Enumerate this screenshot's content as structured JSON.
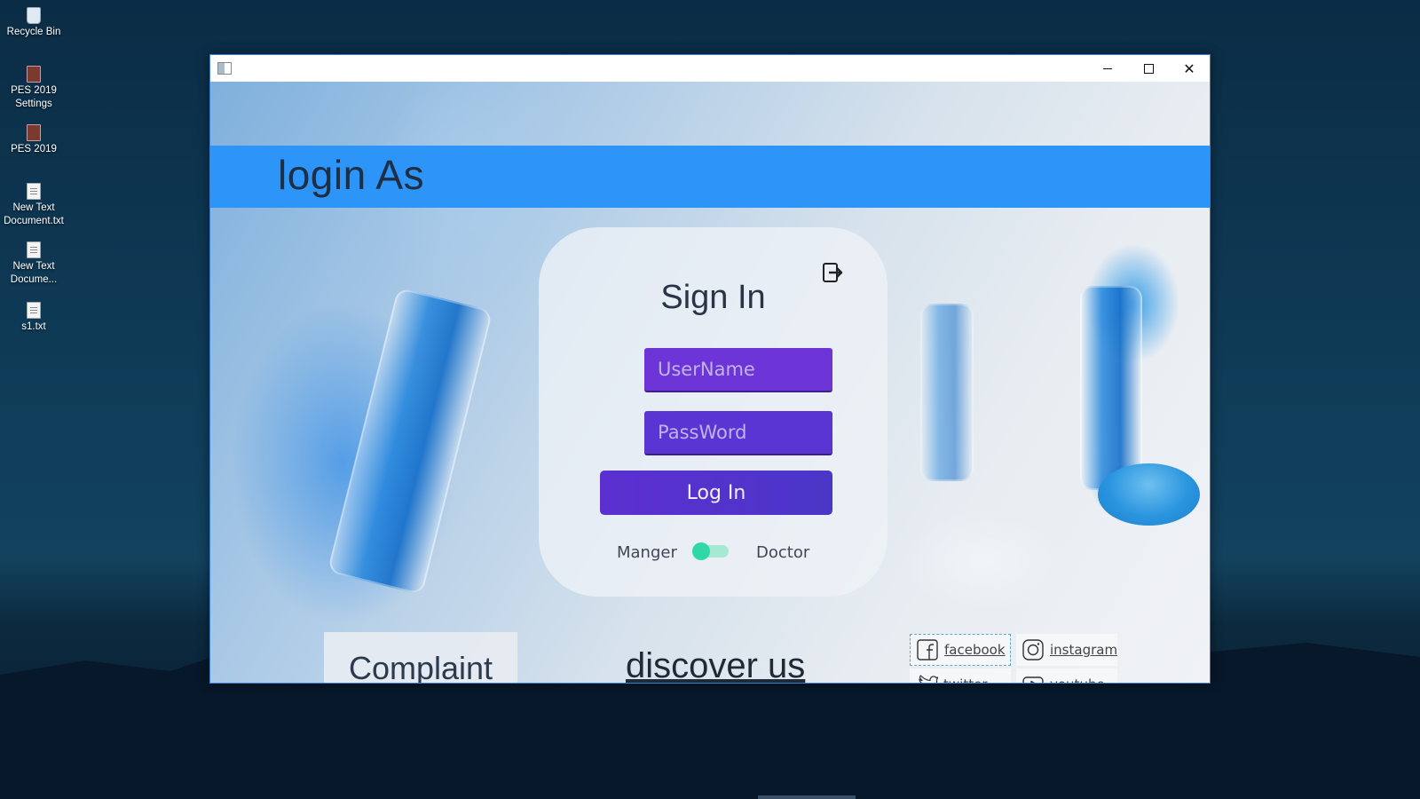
{
  "desktop": {
    "icons": [
      {
        "label": "Recycle Bin",
        "icon": "recycle-bin-icon"
      },
      {
        "label": "PES 2019 Settings",
        "icon": "app-icon"
      },
      {
        "label": "PES 2019",
        "icon": "app-icon"
      },
      {
        "label": "New Text Document.txt",
        "icon": "text-file-icon"
      },
      {
        "label": "New Text Docume...",
        "icon": "text-file-icon"
      },
      {
        "label": "s1.txt",
        "icon": "text-file-icon"
      }
    ]
  },
  "window": {
    "controls": {
      "minimize": "–",
      "maximize": "□",
      "close": "✕"
    }
  },
  "header": {
    "title": "login As",
    "band_color": "#2d95f8"
  },
  "signin": {
    "title": "Sign In",
    "username_placeholder": "UserName",
    "password_placeholder": "PassWord",
    "login_label": "Log In",
    "role_toggle": {
      "left_label": "Manger",
      "right_label": "Doctor",
      "selected": "Manger"
    },
    "accent_color": "#6d34d8"
  },
  "footer": {
    "complaint_label": "Complaint",
    "discover_label": "discover us",
    "social_links": {
      "facebook": "facebook",
      "instagram": "instagram",
      "twitter": "twitter",
      "youtube": "youtube"
    }
  }
}
